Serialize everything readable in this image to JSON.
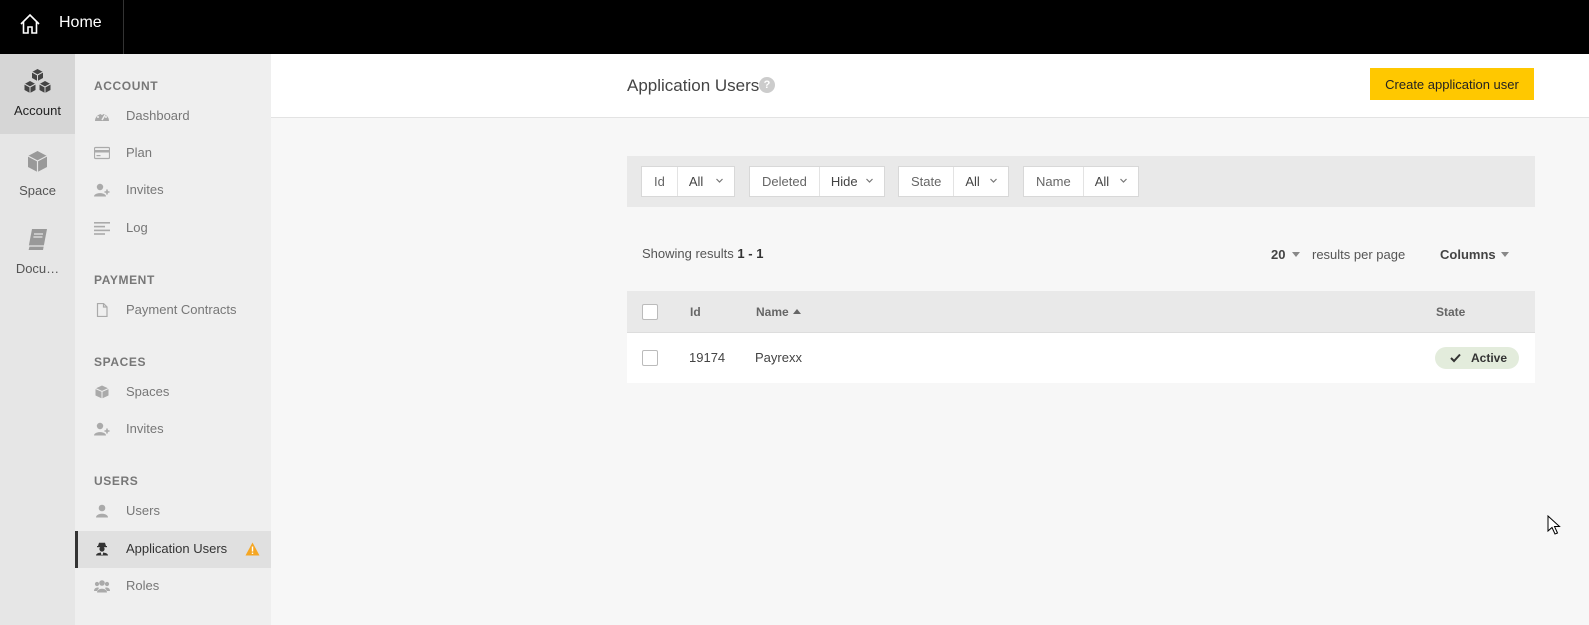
{
  "topbar": {
    "home_label": "Home"
  },
  "rail": [
    {
      "label": "Account",
      "icon": "cubes-icon",
      "active": true
    },
    {
      "label": "Space",
      "icon": "cube-icon",
      "active": false
    },
    {
      "label": "Docu…",
      "icon": "book-icon",
      "active": false
    }
  ],
  "sidebar": {
    "account_title": "ACCOUNT",
    "account_items": [
      {
        "label": "Dashboard",
        "icon": "dashboard-icon"
      },
      {
        "label": "Plan",
        "icon": "credit-card-icon"
      },
      {
        "label": "Invites",
        "icon": "user-plus-icon"
      },
      {
        "label": "Log",
        "icon": "list-icon"
      }
    ],
    "payment_title": "PAYMENT",
    "payment_items": [
      {
        "label": "Payment Contracts",
        "icon": "document-icon"
      }
    ],
    "spaces_title": "SPACES",
    "spaces_items": [
      {
        "label": "Spaces",
        "icon": "cube-icon"
      },
      {
        "label": "Invites",
        "icon": "user-plus-icon"
      }
    ],
    "users_title": "USERS",
    "users_items": [
      {
        "label": "Users",
        "icon": "user-icon"
      },
      {
        "label": "Application Users",
        "icon": "agent-icon",
        "active": true,
        "warning": true
      },
      {
        "label": "Roles",
        "icon": "users-icon"
      }
    ]
  },
  "header": {
    "title": "Application Users",
    "help": "?",
    "create_button": "Create application user"
  },
  "filters": [
    {
      "label": "Id",
      "value": "All"
    },
    {
      "label": "Deleted",
      "value": "Hide"
    },
    {
      "label": "State",
      "value": "All"
    },
    {
      "label": "Name",
      "value": "All"
    }
  ],
  "results": {
    "showing_prefix": "Showing results",
    "range": "1 - 1",
    "per_page": "20",
    "per_page_label": "results per page",
    "columns_label": "Columns"
  },
  "table": {
    "columns": {
      "id": "Id",
      "name": "Name",
      "state": "State"
    },
    "rows": [
      {
        "id": "19174",
        "name": "Payrexx",
        "state": "Active"
      }
    ]
  },
  "colors": {
    "accent": "#ffc800",
    "topbar": "#000000",
    "active_badge": "#e3ecdc",
    "warning": "#f5a623"
  }
}
